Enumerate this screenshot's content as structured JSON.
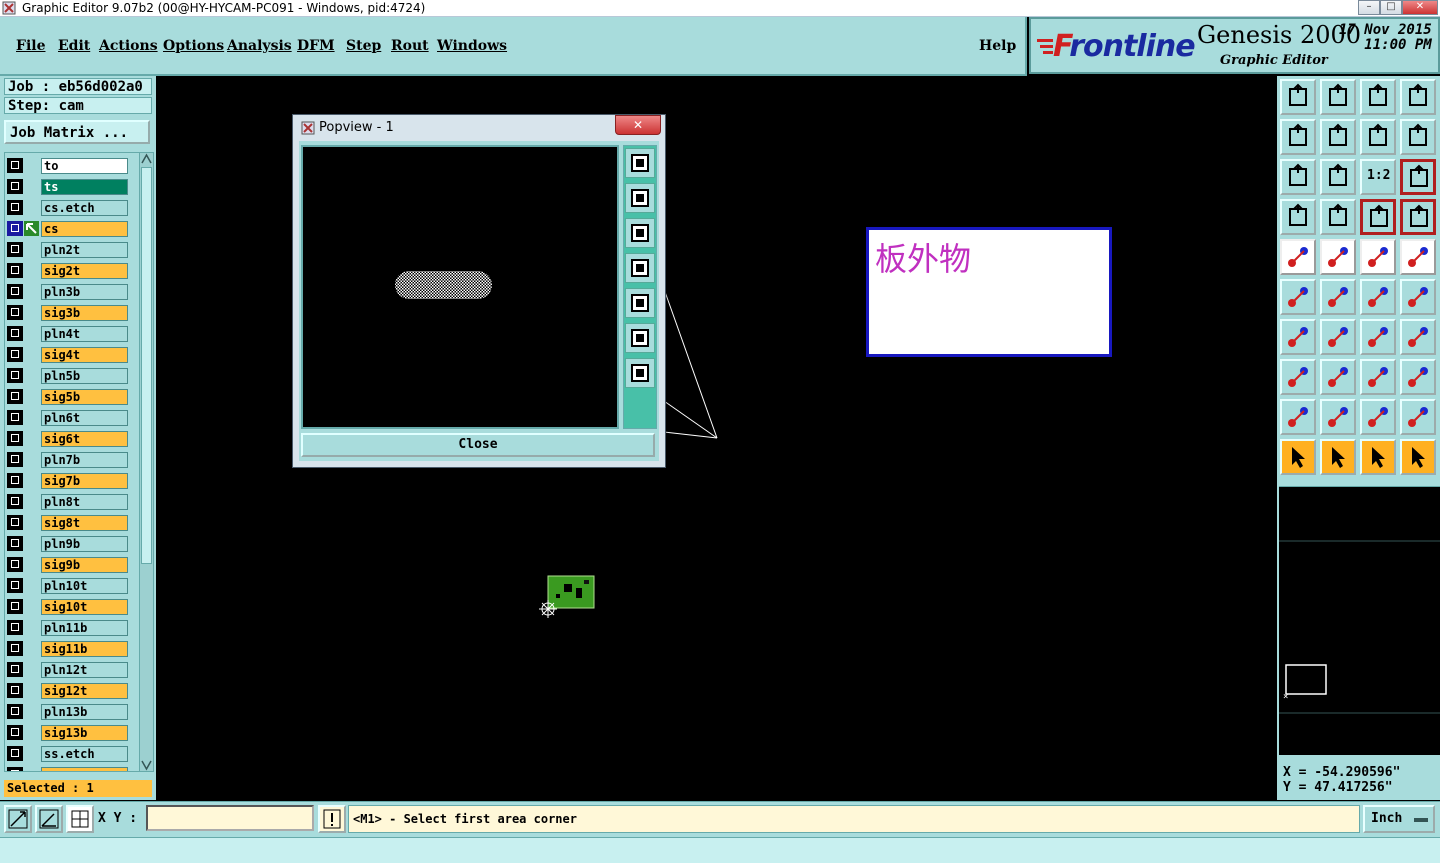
{
  "window": {
    "title": "Graphic Editor 9.07b2 (00@HY-HYCAM-PC091 - Windows, pid:4724)",
    "controls": [
      "–",
      "□",
      "✕"
    ]
  },
  "menu": {
    "items": [
      "File",
      "Edit",
      "Actions",
      "Options",
      "Analysis",
      "DFM",
      "Step",
      "Rout",
      "Windows"
    ],
    "help": "Help"
  },
  "brand": {
    "logo": "Frontline",
    "product": "Genesis 2000",
    "subtitle": "Graphic Editor",
    "date": "17 Nov 2015",
    "time": "11:00 PM"
  },
  "job": {
    "job_line": "Job : eb56d002a0",
    "step_line": "Step: cam",
    "matrix_button": "Job Matrix ..."
  },
  "layers": [
    {
      "name": "to",
      "style": "white"
    },
    {
      "name": "ts",
      "style": "green"
    },
    {
      "name": "cs.etch",
      "style": "plain"
    },
    {
      "name": "cs",
      "style": "orange",
      "active": true
    },
    {
      "name": "pln2t",
      "style": "plain"
    },
    {
      "name": "sig2t",
      "style": "orange"
    },
    {
      "name": "pln3b",
      "style": "plain"
    },
    {
      "name": "sig3b",
      "style": "orange"
    },
    {
      "name": "pln4t",
      "style": "plain"
    },
    {
      "name": "sig4t",
      "style": "orange"
    },
    {
      "name": "pln5b",
      "style": "plain"
    },
    {
      "name": "sig5b",
      "style": "orange"
    },
    {
      "name": "pln6t",
      "style": "plain"
    },
    {
      "name": "sig6t",
      "style": "orange"
    },
    {
      "name": "pln7b",
      "style": "plain"
    },
    {
      "name": "sig7b",
      "style": "orange"
    },
    {
      "name": "pln8t",
      "style": "plain"
    },
    {
      "name": "sig8t",
      "style": "orange"
    },
    {
      "name": "pln9b",
      "style": "plain"
    },
    {
      "name": "sig9b",
      "style": "orange"
    },
    {
      "name": "pln10t",
      "style": "plain"
    },
    {
      "name": "sig10t",
      "style": "orange"
    },
    {
      "name": "pln11b",
      "style": "plain"
    },
    {
      "name": "sig11b",
      "style": "orange"
    },
    {
      "name": "pln12t",
      "style": "plain"
    },
    {
      "name": "sig12t",
      "style": "orange"
    },
    {
      "name": "pln13b",
      "style": "plain"
    },
    {
      "name": "sig13b",
      "style": "orange"
    },
    {
      "name": "ss.etch",
      "style": "plain"
    },
    {
      "name": "ss",
      "style": "orange"
    }
  ],
  "selected": "Selected : 1",
  "popview": {
    "title": "Popview - 1",
    "close_button": "Close",
    "tool_icons": [
      "zoom-window-icon",
      "zoom-in-icon",
      "zoom-out-icon",
      "pan-left-icon",
      "pan-right-icon",
      "zoom-fit-icon",
      "zoom-home-icon"
    ]
  },
  "note": {
    "text": "板外物"
  },
  "palette": {
    "tool_icons": [
      "zoom-in-icon",
      "zoom-out-icon",
      "home-icon",
      "window-icon",
      "pan-left-icon",
      "pan-right-icon",
      "swap-icon",
      "s-curve-icon",
      "fit-icon",
      "center-icon",
      "scale-1-2-icon",
      "help-icon",
      "tools-icon",
      "grid-icon",
      "snap-red-icon",
      "snap-blue-icon",
      "pad-icon",
      "line-diagonal-icon",
      "ruler-icon",
      "circle-icon",
      "node-icon",
      "cross-icon",
      "arc-red-icon",
      "arc-blue-icon",
      "angle-icon",
      "slash-icon",
      "rotate-icon",
      "text-icon",
      "pads-icon",
      "dash-icon",
      "measure-icon",
      "shapes-icon",
      "triangle-icon",
      "triangle-up-icon",
      "triangle-a-icon",
      "triangle-b-icon",
      "select-icon",
      "select-box-icon",
      "select-point-icon",
      "route-icon"
    ],
    "scale_label": "1:2"
  },
  "coords": {
    "x": "X = -54.290596\"",
    "y": "Y = 47.417256\""
  },
  "status": {
    "xy_label": "X Y :",
    "xy_value": "",
    "prompt": "<M1> - Select first area corner",
    "unit": "Inch"
  },
  "colors": {
    "panel": "#a8dcdc",
    "orange": "#ffc040",
    "canvas": "#000000"
  }
}
